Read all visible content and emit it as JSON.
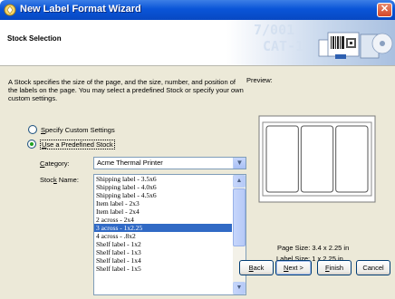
{
  "window": {
    "title": "New Label Format Wizard"
  },
  "header": {
    "title": "Stock Selection"
  },
  "description": "A Stock specifies the size of the page, and the size, number, and position of the labels on the page. You may select a predefined Stock or specify your own custom settings.",
  "options": {
    "custom": {
      "pre": "",
      "accel": "S",
      "post": "pecify Custom Settings",
      "selected": false
    },
    "predefined": {
      "pre": "",
      "accel": "U",
      "post": "se a Predefined Stock",
      "selected": true
    }
  },
  "category": {
    "label_accel": "C",
    "label_post": "ategory:",
    "value": "Acme Thermal Printer"
  },
  "stock_name": {
    "label_pre": "Stoc",
    "label_accel": "k",
    "label_post": " Name:",
    "items": [
      "Shipping label - 3.5x6",
      "Shipping label - 4.0x6",
      "Shipping label - 4.5x6",
      "Item label - 2x3",
      "Item label - 2x4",
      "2 across - 2x4",
      "3 across - 1x2.25",
      "4 across - .8x2",
      "Shelf label - 1x2",
      "Shelf label - 1x3",
      "Shelf label - 1x4",
      "Shelf label - 1x5"
    ],
    "selected_index": 6
  },
  "preview": {
    "label": "Preview:",
    "page_size_label": "Page Size:",
    "page_size_value": "3.4 x 2.25 in",
    "label_size_label": "Label Size:",
    "label_size_value": "1 x 2.25 in",
    "columns": 3
  },
  "buttons": {
    "back": {
      "pre": "",
      "accel": "B",
      "post": "ack"
    },
    "next": {
      "pre": "",
      "accel": "N",
      "post": "ext >"
    },
    "finish": {
      "pre": "",
      "accel": "F",
      "post": "inish"
    },
    "cancel": "Cancel"
  },
  "header_watermark": [
    "7/001",
    "CAT-1",
    "-1/2"
  ],
  "colors": {
    "titlebar": "#0a55d8",
    "selection": "#316ac5",
    "dialog_bg": "#ece9d8"
  }
}
